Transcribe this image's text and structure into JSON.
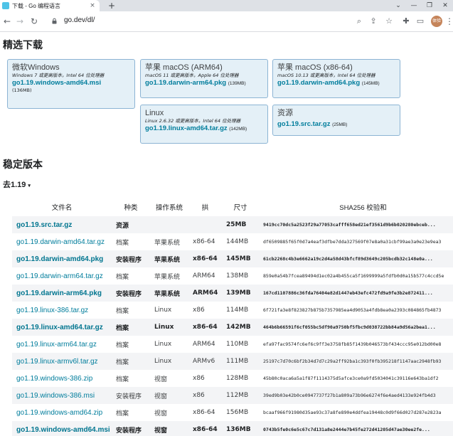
{
  "browser": {
    "tab_title": "下载 - Go 编程语言",
    "tab_close": "×",
    "new_tab": "+",
    "url": "go.dev/dl/",
    "avatar_text": "体验",
    "window_controls": [
      "⌄",
      "—",
      "❐",
      "✕"
    ]
  },
  "page": {
    "featured_heading": "精选下载",
    "stable_heading": "稳定版本",
    "version_toggle": "去1.19",
    "version_caret": "▾"
  },
  "featured": [
    {
      "title": "微软Windows",
      "note": "Windows 7 或更高版本，Intel 64 位处理器",
      "file": "go1.19.windows-amd64.msi",
      "size": "(136MB)"
    },
    {
      "title": "苹果 macOS (ARM64)",
      "note": "macOS 11 或更高版本，Apple 64 位处理器",
      "file": "go1.19.darwin-arm64.pkg",
      "size": "(139MB)"
    },
    {
      "title": "苹果 macOS (x86-64)",
      "note": "macOS 10.13 或更高版本，Intel 64 位处理器",
      "file": "go1.19.darwin-amd64.pkg",
      "size": "(145MB)"
    },
    {
      "title": "Linux",
      "note": "Linux 2.6.32 或更高版本，Intel 64 位处理器",
      "file": "go1.19.linux-amd64.tar.gz",
      "size": "(142MB)"
    },
    {
      "title": "资源",
      "note": "",
      "file": "go1.19.src.tar.gz",
      "size": "(25MB)"
    }
  ],
  "table": {
    "headers": [
      "文件名",
      "种类",
      "操作系统",
      "拱",
      "尺寸",
      "SHA256 校验和"
    ],
    "rows": [
      {
        "file": "go1.19.src.tar.gz",
        "kind": "资源",
        "os": "",
        "arch": "",
        "size": "25MB",
        "sha": "9419cc70dc5a2523f29a77053cafff658ed21ef3561d9b6b020280ebcеb..."
      },
      {
        "file": "go1.19.darwin-amd64.tar.gz",
        "kind": "档案",
        "os": "苹果系统",
        "arch": "x86-64",
        "size": "144MB",
        "sha": "df6509885f65f0d7a4eaf3dfbe7dda327569f07e8a0a31cbf99ae3a0e23e9ea3"
      },
      {
        "file": "go1.19.darwin-amd64.pkg",
        "kind": "安装程序",
        "os": "苹果系统",
        "arch": "x86-64",
        "size": "145MB",
        "sha": "61cb2268c4b3e6662a19c2d4a58d43bfcf89d3649c205bcdb32c148e0a..."
      },
      {
        "file": "go1.19.darwin-arm64.tar.gz",
        "kind": "档案",
        "os": "苹果系统",
        "arch": "ARM64",
        "size": "138MB",
        "sha": "859e0a54b7fcea89494d1ec02a4b455ca5f1699999a5fdfb0d0a15b577c4ccd5e"
      },
      {
        "file": "go1.19.darwin-arm64.pkg",
        "kind": "安装程序",
        "os": "苹果系统",
        "arch": "ARM64",
        "size": "139MB",
        "sha": "167cd1107886c36fda76404e82d1447eb43efc472fd9a9fe3b2e872411..."
      },
      {
        "file": "go1.19.linux-386.tar.gz",
        "kind": "档案",
        "os": "Linux",
        "arch": "x86",
        "size": "114MB",
        "sha": "6f721fa3e8f823827b875b7357985ea4d9053a4fdb8ea0a2393c084865fb4873"
      },
      {
        "file": "go1.19.linux-amd64.tar.gz",
        "kind": "档案",
        "os": "Linux",
        "arch": "x86-64",
        "size": "142MB",
        "sha": "464b6b66591f6cf055bc5df90a9750bf5fbc9d038722bb84a9d56a2bea1..."
      },
      {
        "file": "go1.19.linux-arm64.tar.gz",
        "kind": "档案",
        "os": "Linux",
        "arch": "ARM64",
        "size": "110MB",
        "sha": "efa97fac9574fc6ef6c9ff3e3758fb85f1439b046573bf434ccc95e012bd00e8"
      },
      {
        "file": "go1.19.linux-armv6l.tar.gz",
        "kind": "档案",
        "os": "Linux",
        "arch": "ARMv6",
        "size": "111MB",
        "sha": "25197c7d70c6bf2b34d7d7c29a2ff92ba1c393f0fb395218f1147aac2948fb93"
      },
      {
        "file": "go1.19.windows-386.zip",
        "kind": "档案",
        "os": "视窗",
        "arch": "x86",
        "size": "128MB",
        "sha": "45b80c0aca6a5a1f87f1114375d5afce3ce0a9fd5034041c39116e643ba1df2"
      },
      {
        "file": "go1.19.windows-386.msi",
        "kind": "安装程序",
        "os": "视窗",
        "arch": "x86",
        "size": "112MB",
        "sha": "39ed9b03e42b0ce0947737f27b1a809a73b96e6274f6e4aed4133e924fb4d3"
      },
      {
        "file": "go1.19.windows-amd64.zip",
        "kind": "档案",
        "os": "视窗",
        "arch": "x86-64",
        "size": "156MB",
        "sha": "bcaaf966f91980d35ae93c37a8fe890e4ddfea19448c0d9f66d027d287e2823a"
      },
      {
        "file": "go1.19.windows-amd64.msi",
        "kind": "安装程序",
        "os": "视窗",
        "arch": "x86-64",
        "size": "136MB",
        "sha": "0743b5fe0c6e5c67c7d131a8e2444e7b45fe272d41205d47ae30ee2fe..."
      }
    ]
  },
  "colors": {
    "link": "#007d9c",
    "card_bg": "#e4f0f7",
    "card_border": "#8cb4d4",
    "stripe": "#f3f4f6"
  }
}
